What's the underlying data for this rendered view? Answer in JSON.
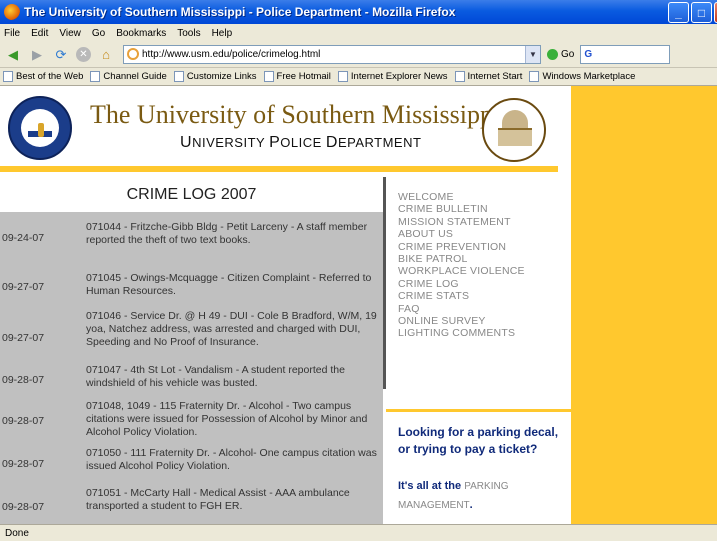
{
  "window": {
    "title": "The University of Southern Mississippi - Police Department - Mozilla Firefox"
  },
  "menu": [
    "File",
    "Edit",
    "View",
    "Go",
    "Bookmarks",
    "Tools",
    "Help"
  ],
  "nav": {
    "url": "http://www.usm.edu/police/crimelog.html",
    "go_label": "Go",
    "search_value": "G"
  },
  "bookmarks": [
    "Best of the Web",
    "Channel Guide",
    "Customize Links",
    "Free Hotmail",
    "Internet Explorer News",
    "Internet Start",
    "Windows Marketplace"
  ],
  "header": {
    "university": "The University of Southern Mississippi",
    "department_cap1": "U",
    "department_rest1": "NIVERSITY ",
    "department_cap2": "P",
    "department_rest2": "OLICE ",
    "department_cap3": "D",
    "department_rest3": "EPARTMENT"
  },
  "crime_log": {
    "heading": "CRIME LOG 2007",
    "entries": [
      {
        "date": "09-24-07",
        "text": "071044 - Fritzche-Gibb Bldg - Petit Larceny - A staff member reported the theft of two text books."
      },
      {
        "date": "09-27-07",
        "text": "071045 - Owings-Mcquagge - Citizen Complaint - Referred to Human Resources."
      },
      {
        "date": "09-27-07",
        "text": "071046 - Service Dr. @ H 49 - DUI - Cole B Bradford, W/M, 19 yoa, Natchez address, was arrested and charged with DUI, Speeding and No Proof of Insurance."
      },
      {
        "date": "09-28-07",
        "text": "071047 - 4th St Lot - Vandalism - A student reported the windshield of his vehicle was busted."
      },
      {
        "date": "09-28-07",
        "text": "071048, 1049 - 115 Fraternity Dr. - Alcohol - Two campus citations were issued for Possession of Alcohol by Minor and Alcohol Policy Violation."
      },
      {
        "date": "09-28-07",
        "text": "071050 - 111 Fraternity Dr. - Alcohol- One campus citation was issued Alcohol Policy Violation."
      },
      {
        "date": "09-28-07",
        "text": "071051 - McCarty Hall - Medical Assist - AAA ambulance transported a student to FGH ER."
      }
    ]
  },
  "site_nav": [
    "WELCOME",
    "CRIME BULLETIN",
    "MISSION STATEMENT",
    "ABOUT US",
    "CRIME PREVENTION",
    "BIKE PATROL",
    "WORKPLACE VIOLENCE",
    "CRIME LOG",
    "CRIME STATS",
    "FAQ",
    "ONLINE SURVEY",
    "LIGHTING COMMENTS"
  ],
  "parking": {
    "question": "Looking for a parking decal, or trying to pay a ticket?",
    "answer_prefix": "It's all at the ",
    "link": "PARKING MANAGEMENT",
    "suffix": "."
  },
  "status": "Done"
}
